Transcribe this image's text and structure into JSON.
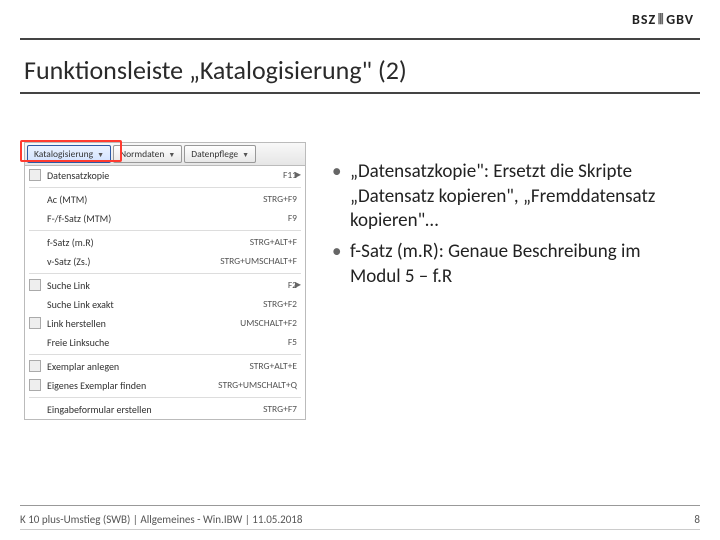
{
  "header": {
    "logo_left": "BSZ",
    "logo_right": "GBV"
  },
  "title": "Funktionsleiste „Katalogisierung\" (2)",
  "menubar": {
    "items": [
      {
        "label": "Katalogisierung"
      },
      {
        "label": "Normdaten"
      },
      {
        "label": "Datenpflege"
      }
    ]
  },
  "dropdown": {
    "groups": [
      [
        {
          "label": "Datensatzkopie",
          "shortcut": "F11",
          "flyout": true,
          "icon": true
        }
      ],
      [
        {
          "label": "Ac (MTM)",
          "shortcut": "STRG+F9"
        },
        {
          "label": "F-/f-Satz (MTM)",
          "shortcut": "F9"
        }
      ],
      [
        {
          "label": "f-Satz (m.R)",
          "shortcut": "STRG+ALT+F"
        },
        {
          "label": "v-Satz (Zs.)",
          "shortcut": "STRG+UMSCHALT+F"
        }
      ],
      [
        {
          "label": "Suche Link",
          "shortcut": "F2",
          "flyout": true,
          "icon": true
        },
        {
          "label": "Suche Link exakt",
          "shortcut": "STRG+F2"
        },
        {
          "label": "Link herstellen",
          "shortcut": "UMSCHALT+F2",
          "icon": true
        },
        {
          "label": "Freie Linksuche",
          "shortcut": "F5"
        }
      ],
      [
        {
          "label": "Exemplar anlegen",
          "shortcut": "STRG+ALT+E",
          "icon": true
        },
        {
          "label": "Eigenes Exemplar finden",
          "shortcut": "STRG+UMSCHALT+Q",
          "icon": true
        }
      ],
      [
        {
          "label": "Eingabeformular erstellen",
          "shortcut": "STRG+F7"
        }
      ]
    ]
  },
  "bullets": [
    "„Datensatzkopie\": Ersetzt die Skripte „Datensatz kopieren\", „Fremddatensatz kopieren\"…",
    "f-Satz (m.R): Genaue Beschreibung im Modul 5 – f.R"
  ],
  "footer": {
    "left": "K 10 plus-Umstieg (SWB) | Allgemeines - Win.IBW | 11.05.2018",
    "page": "8"
  }
}
